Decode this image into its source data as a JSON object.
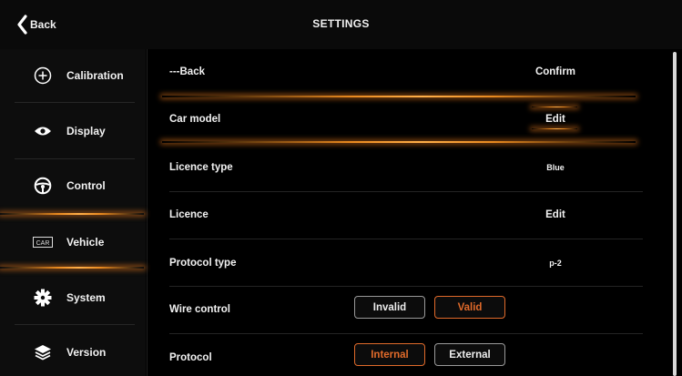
{
  "header": {
    "back_label": "Back",
    "title": "SETTINGS"
  },
  "sidebar": {
    "items": [
      {
        "label": "Calibration",
        "icon": "plus-circle-icon"
      },
      {
        "label": "Display",
        "icon": "eye-icon"
      },
      {
        "label": "Control",
        "icon": "steering-wheel-icon"
      },
      {
        "label": "Vehicle",
        "icon": "car-badge-icon",
        "badge": "CAR"
      },
      {
        "label": "System",
        "icon": "gear-icon"
      },
      {
        "label": "Version",
        "icon": "layers-icon"
      }
    ],
    "selected": "Vehicle",
    "accent_color": "#e8891f"
  },
  "main": {
    "rows": [
      {
        "label": "---Back",
        "value": "Confirm"
      },
      {
        "label": "Car model",
        "value": "Edit"
      },
      {
        "label": "Licence type",
        "value": "Blue"
      },
      {
        "label": "Licence",
        "value": "Edit"
      },
      {
        "label": "Protocol type",
        "value": "p-2"
      },
      {
        "label": "Wire control",
        "options": [
          "Invalid",
          "Valid"
        ],
        "selected": "Valid"
      },
      {
        "label": "Protocol",
        "options": [
          "Internal",
          "External"
        ],
        "selected": "Internal"
      }
    ],
    "selected_row": "Car model",
    "active_option_color": "#e06a2a"
  }
}
